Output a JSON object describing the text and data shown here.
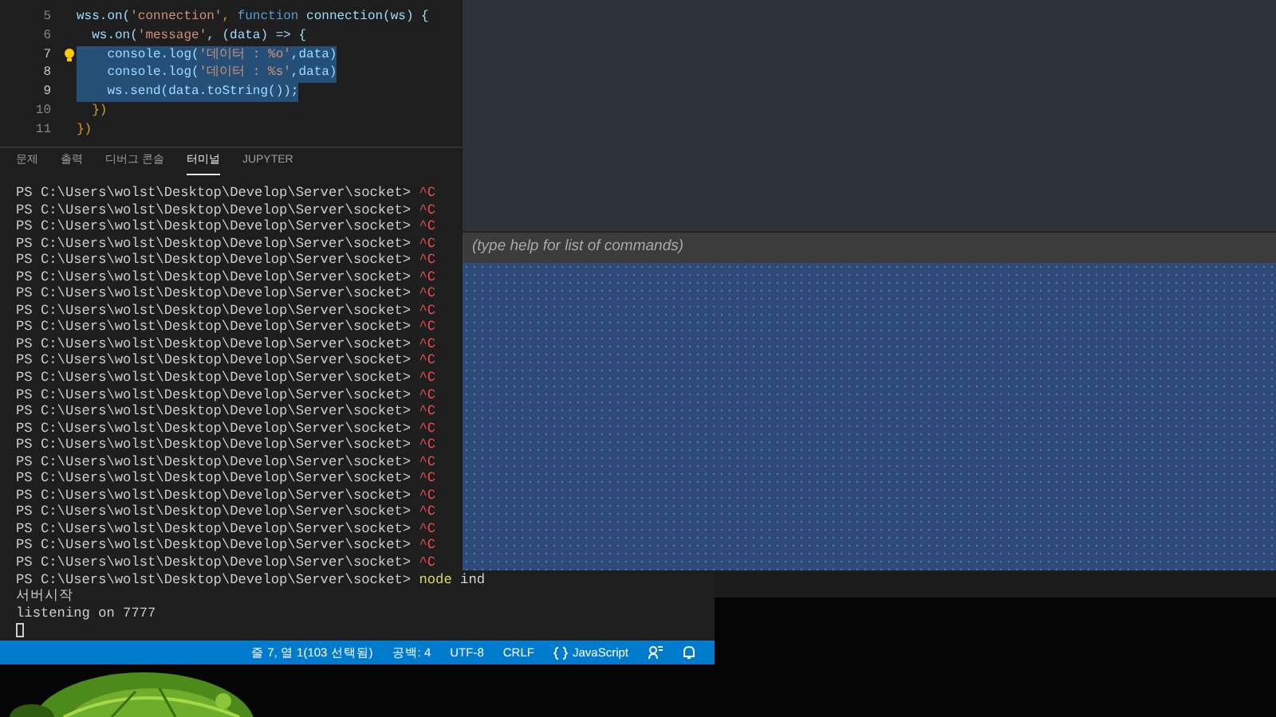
{
  "editor": {
    "lines": [
      {
        "number": "5",
        "selected": false,
        "lightbulb": false,
        "tokens": [
          {
            "text": "wss.on(",
            "kind": "var"
          },
          {
            "text": "'connection'",
            "kind": "string"
          },
          {
            "text": ", ",
            "kind": "punct"
          },
          {
            "text": "function",
            "kind": "keyword"
          },
          {
            "text": " connection(ws) {",
            "kind": "var"
          }
        ]
      },
      {
        "number": "6",
        "selected": false,
        "lightbulb": false,
        "tokens": [
          {
            "text": "  ws.on(",
            "kind": "var"
          },
          {
            "text": "'message'",
            "kind": "string"
          },
          {
            "text": ", (data) => {",
            "kind": "var"
          }
        ]
      },
      {
        "number": "7",
        "selected": true,
        "lightbulb": true,
        "tokens": [
          {
            "text": "    console.log(",
            "kind": "var"
          },
          {
            "text": "'데이터 : %o'",
            "kind": "string"
          },
          {
            "text": ",data)",
            "kind": "var"
          }
        ]
      },
      {
        "number": "8",
        "selected": true,
        "lightbulb": false,
        "tokens": [
          {
            "text": "    console.log(",
            "kind": "var"
          },
          {
            "text": "'데이터 : %s'",
            "kind": "string"
          },
          {
            "text": ",data)",
            "kind": "var"
          }
        ]
      },
      {
        "number": "9",
        "selected": true,
        "lightbulb": false,
        "tokens": [
          {
            "text": "    ws.send(data.toString());",
            "kind": "var"
          }
        ]
      },
      {
        "number": "10",
        "selected": false,
        "lightbulb": false,
        "tokens": [
          {
            "text": "  })",
            "kind": "punct"
          }
        ]
      },
      {
        "number": "11",
        "selected": false,
        "lightbulb": false,
        "tokens": [
          {
            "text": "})",
            "kind": "punct"
          }
        ]
      }
    ]
  },
  "panel_tabs": [
    {
      "label": "문제",
      "selected": false
    },
    {
      "label": "출력",
      "selected": false
    },
    {
      "label": "디버그 콘솔",
      "selected": false
    },
    {
      "label": "터미널",
      "selected": true
    },
    {
      "label": "JUPYTER",
      "selected": false
    }
  ],
  "terminal": {
    "lines": [
      {
        "kind": "prompt",
        "prompt": "PS C:\\Users\\wolst\\Desktop\\Develop\\Server\\socket>",
        "tokens": [
          {
            "text": "^C",
            "kind": "error"
          }
        ]
      },
      {
        "kind": "prompt",
        "prompt": "PS C:\\Users\\wolst\\Desktop\\Develop\\Server\\socket>",
        "tokens": [
          {
            "text": "^C",
            "kind": "error"
          }
        ]
      },
      {
        "kind": "prompt",
        "prompt": "PS C:\\Users\\wolst\\Desktop\\Develop\\Server\\socket>",
        "tokens": [
          {
            "text": "^C",
            "kind": "error"
          }
        ]
      },
      {
        "kind": "prompt",
        "prompt": "PS C:\\Users\\wolst\\Desktop\\Develop\\Server\\socket>",
        "tokens": [
          {
            "text": "^C",
            "kind": "error"
          }
        ]
      },
      {
        "kind": "prompt",
        "prompt": "PS C:\\Users\\wolst\\Desktop\\Develop\\Server\\socket>",
        "tokens": [
          {
            "text": "^C",
            "kind": "error"
          }
        ]
      },
      {
        "kind": "prompt",
        "prompt": "PS C:\\Users\\wolst\\Desktop\\Develop\\Server\\socket>",
        "tokens": [
          {
            "text": "^C",
            "kind": "error"
          }
        ]
      },
      {
        "kind": "prompt",
        "prompt": "PS C:\\Users\\wolst\\Desktop\\Develop\\Server\\socket>",
        "tokens": [
          {
            "text": "^C",
            "kind": "error"
          }
        ]
      },
      {
        "kind": "prompt",
        "prompt": "PS C:\\Users\\wolst\\Desktop\\Develop\\Server\\socket>",
        "tokens": [
          {
            "text": "^C",
            "kind": "error"
          }
        ]
      },
      {
        "kind": "prompt",
        "prompt": "PS C:\\Users\\wolst\\Desktop\\Develop\\Server\\socket>",
        "tokens": [
          {
            "text": "^C",
            "kind": "error"
          }
        ]
      },
      {
        "kind": "prompt",
        "prompt": "PS C:\\Users\\wolst\\Desktop\\Develop\\Server\\socket>",
        "tokens": [
          {
            "text": "^C",
            "kind": "error"
          }
        ]
      },
      {
        "kind": "prompt",
        "prompt": "PS C:\\Users\\wolst\\Desktop\\Develop\\Server\\socket>",
        "tokens": [
          {
            "text": "^C",
            "kind": "error"
          }
        ]
      },
      {
        "kind": "prompt",
        "prompt": "PS C:\\Users\\wolst\\Desktop\\Develop\\Server\\socket>",
        "tokens": [
          {
            "text": "^C",
            "kind": "error"
          }
        ]
      },
      {
        "kind": "prompt",
        "prompt": "PS C:\\Users\\wolst\\Desktop\\Develop\\Server\\socket>",
        "tokens": [
          {
            "text": "^C",
            "kind": "error"
          }
        ]
      },
      {
        "kind": "prompt",
        "prompt": "PS C:\\Users\\wolst\\Desktop\\Develop\\Server\\socket>",
        "tokens": [
          {
            "text": "^C",
            "kind": "error"
          }
        ]
      },
      {
        "kind": "prompt",
        "prompt": "PS C:\\Users\\wolst\\Desktop\\Develop\\Server\\socket>",
        "tokens": [
          {
            "text": "^C",
            "kind": "error"
          }
        ]
      },
      {
        "kind": "prompt",
        "prompt": "PS C:\\Users\\wolst\\Desktop\\Develop\\Server\\socket>",
        "tokens": [
          {
            "text": "^C",
            "kind": "error"
          }
        ]
      },
      {
        "kind": "prompt",
        "prompt": "PS C:\\Users\\wolst\\Desktop\\Develop\\Server\\socket>",
        "tokens": [
          {
            "text": "^C",
            "kind": "error"
          }
        ]
      },
      {
        "kind": "prompt",
        "prompt": "PS C:\\Users\\wolst\\Desktop\\Develop\\Server\\socket>",
        "tokens": [
          {
            "text": "^C",
            "kind": "error"
          }
        ]
      },
      {
        "kind": "prompt",
        "prompt": "PS C:\\Users\\wolst\\Desktop\\Develop\\Server\\socket>",
        "tokens": [
          {
            "text": "^C",
            "kind": "error"
          }
        ]
      },
      {
        "kind": "prompt",
        "prompt": "PS C:\\Users\\wolst\\Desktop\\Develop\\Server\\socket>",
        "tokens": [
          {
            "text": "^C",
            "kind": "error"
          }
        ]
      },
      {
        "kind": "prompt",
        "prompt": "PS C:\\Users\\wolst\\Desktop\\Develop\\Server\\socket>",
        "tokens": [
          {
            "text": "^C",
            "kind": "error"
          }
        ]
      },
      {
        "kind": "prompt",
        "prompt": "PS C:\\Users\\wolst\\Desktop\\Develop\\Server\\socket>",
        "tokens": [
          {
            "text": "^C",
            "kind": "error"
          }
        ]
      },
      {
        "kind": "prompt",
        "prompt": "PS C:\\Users\\wolst\\Desktop\\Develop\\Server\\socket>",
        "tokens": [
          {
            "text": "^C",
            "kind": "error"
          }
        ]
      },
      {
        "kind": "prompt",
        "prompt": "PS C:\\Users\\wolst\\Desktop\\Develop\\Server\\socket>",
        "tokens": [
          {
            "text": "node",
            "kind": "command"
          },
          {
            "text": "ind",
            "kind": "arg"
          }
        ]
      },
      {
        "kind": "output",
        "text": "서버시작"
      },
      {
        "kind": "output",
        "text": "listening on 7777"
      },
      {
        "kind": "cursor"
      }
    ]
  },
  "status_bar": {
    "position": "줄 7, 열 1(103 선택됨)",
    "indent": "공백: 4",
    "encoding": "UTF-8",
    "eol": "CRLF",
    "language": "JavaScript"
  },
  "console_window": {
    "input": {
      "placeholder": "(type help for list of commands)"
    }
  }
}
